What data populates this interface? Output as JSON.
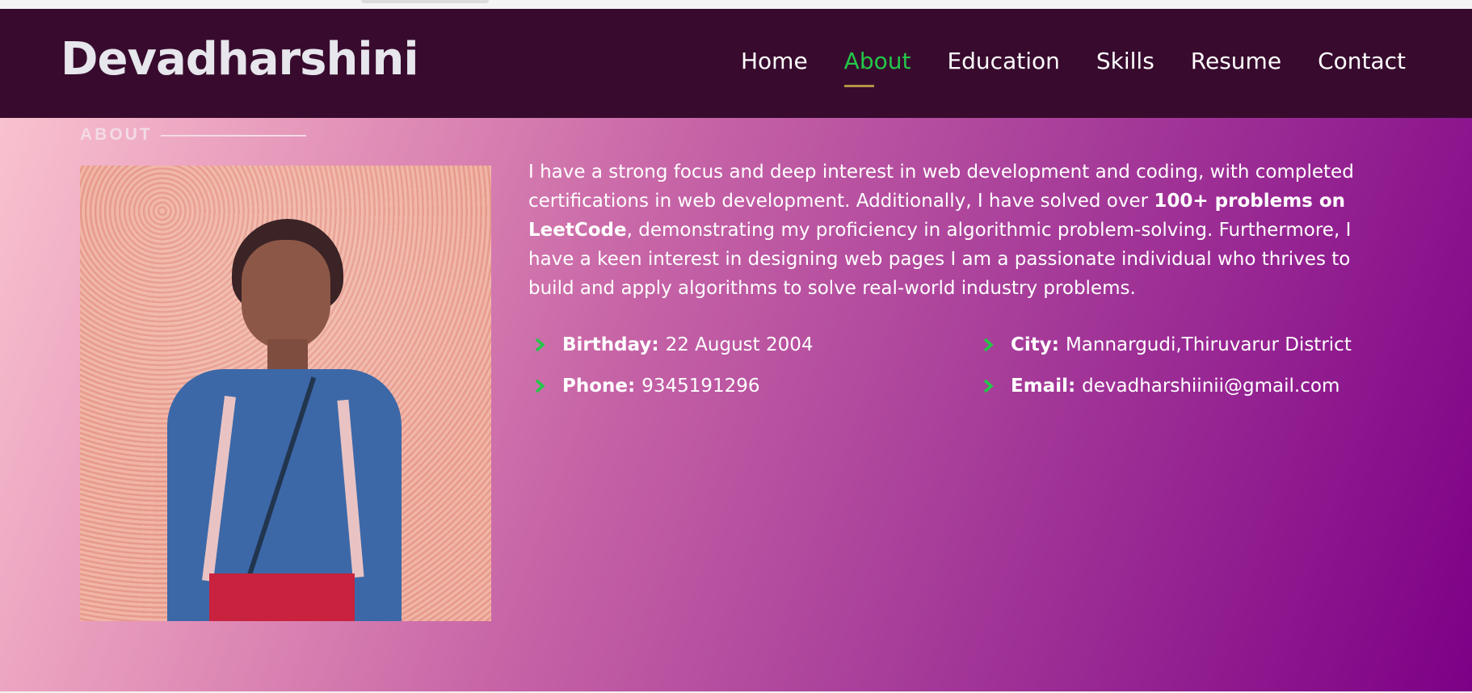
{
  "header": {
    "brand": "Devadharshini",
    "nav": [
      {
        "label": "Home",
        "active": false
      },
      {
        "label": "About",
        "active": true
      },
      {
        "label": "Education",
        "active": false
      },
      {
        "label": "Skills",
        "active": false
      },
      {
        "label": "Resume",
        "active": false
      },
      {
        "label": "Contact",
        "active": false
      }
    ]
  },
  "about": {
    "section_title": "ABOUT",
    "description": {
      "part1": "I have a strong focus and deep interest in web development and coding, with completed certifications in web development. Additionally, I have solved over ",
      "bold": "100+ problems on LeetCode",
      "part2": ", demonstrating my proficiency in algorithmic problem-solving. Furthermore, I have a keen interest in designing web pages I am a passionate individual who thrives to build and apply algorithms to solve real-world industry problems."
    },
    "details": [
      {
        "label": "Birthday:",
        "value": "22 August 2004",
        "icon": "chevron-right-icon"
      },
      {
        "label": "City:",
        "value": "Mannargudi,Thiruvarur District",
        "icon": "chevron-right-icon"
      },
      {
        "label": "Phone:",
        "value": "9345191296",
        "icon": "chevron-right-icon"
      },
      {
        "label": "Email:",
        "value": "devadharshiinii@gmail.com",
        "icon": "chevron-right-icon"
      }
    ]
  },
  "colors": {
    "header_bg": "#380b2e",
    "nav_active": "#23c748",
    "nav_underline": "#b39247",
    "chevron": "#23c748"
  }
}
